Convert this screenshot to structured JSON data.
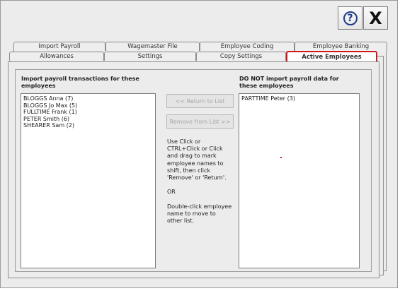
{
  "toolbar": {
    "help_icon": "help-question-icon",
    "help_glyph": "?",
    "close_icon": "close-icon",
    "close_glyph": "X"
  },
  "tabs_row1": [
    {
      "label": "Import Payroll"
    },
    {
      "label": "Wagemaster File"
    },
    {
      "label": "Employee Coding"
    },
    {
      "label": "Employee Banking"
    }
  ],
  "tabs_row2": [
    {
      "label": "Allowances"
    },
    {
      "label": "Settings"
    },
    {
      "label": "Copy Settings"
    },
    {
      "label": "Active Employees",
      "active": true
    }
  ],
  "active_employees": {
    "import_heading": "Import payroll transactions for these employees",
    "import_list": [
      "BLOGGS Anna  (7)",
      "BLOGGS Jo Max (5)",
      "FULLTIME Frank  (1)",
      "PETER Smith  (6)",
      "SHEARER Sam  (2)"
    ],
    "exclude_heading": "DO NOT import payroll data for these employees",
    "exclude_list": [
      "PARTTIME Peter  (3)"
    ],
    "return_button": "<<  Return to List",
    "remove_button": "Remove from List >>",
    "instructions": [
      "Use Click or CTRL+Click or Click and drag to mark employee names to shift, then click 'Remove' or 'Return'.",
      "OR",
      "Double-click employee name to move to other list."
    ]
  },
  "colors": {
    "active_tab_border": "#d01818",
    "help_icon": "#1e3a8a"
  }
}
